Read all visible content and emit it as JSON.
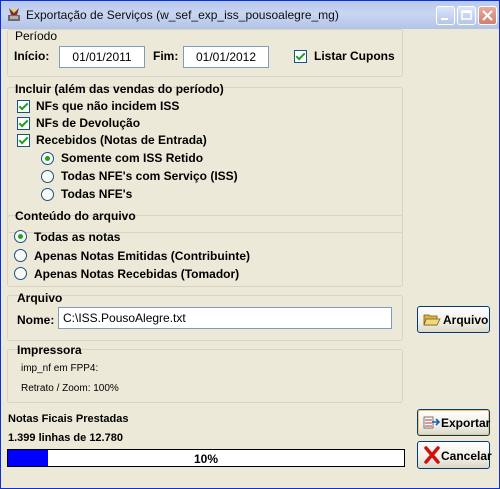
{
  "window": {
    "title": "Exportação de Serviços (w_sef_exp_iss_pousoalegre_mg)"
  },
  "periodo": {
    "legend": "Período",
    "inicio_label": "Início:",
    "inicio_value": "01/01/2011",
    "fim_label": "Fim:",
    "fim_value": "01/01/2012",
    "listar_cupons_label": "Listar Cupons",
    "listar_cupons_checked": true
  },
  "incluir": {
    "legend": "Incluir (além das vendas do período)",
    "nfs_nao_incidem_label": "NFs que não incidem ISS",
    "nfs_devolucao_label": "NFs de Devolução",
    "recebidos_label": "Recebidos (Notas de Entrada)",
    "sub_options": [
      "Somente com ISS Retido",
      "Todas NFE's com Serviço (ISS)",
      "Todas NFE's"
    ],
    "sub_selected": 0
  },
  "conteudo": {
    "legend": "Conteúdo do arquivo",
    "options": [
      "Todas as notas",
      "Apenas Notas Emitidas (Contribuinte)",
      "Apenas Notas Recebidas (Tomador)"
    ],
    "selected": 0
  },
  "arquivo": {
    "legend": "Arquivo",
    "nome_label": "Nome:",
    "nome_value": "C:\\ISS.PousoAlegre.txt",
    "button_label": "Arquivo"
  },
  "impressora": {
    "legend": "Impressora",
    "printer": "imp_nf em FPP4:",
    "zoom": "Retrato / Zoom: 100%"
  },
  "status": {
    "title": "Notas Ficais Prestadas",
    "lines": "1.399 linhas de 12.780",
    "progress_percent": 10,
    "progress_label": "10%"
  },
  "buttons": {
    "exportar_label": "Exportar",
    "cancelar_label": "Cancelar"
  },
  "colors": {
    "progress_fill": "#0000ff",
    "check_mark": "#21a121",
    "titlebar": "#c2d1f0"
  }
}
